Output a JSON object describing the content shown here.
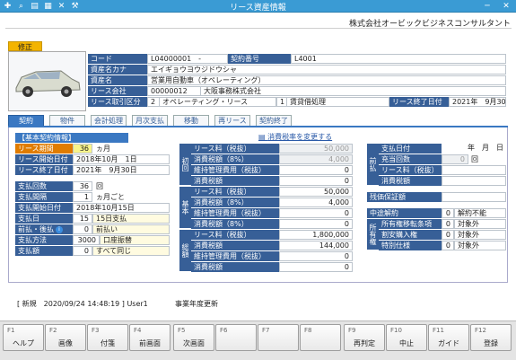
{
  "window": {
    "title": "リース資産情報"
  },
  "company": "株式会社オービックビジネスコンサルタント",
  "badge": "修正",
  "header": {
    "code_label": "コード",
    "code_value": "L04000001　-",
    "contract_no_label": "契約番号",
    "contract_no_value": "L4001",
    "asset_kana_label": "資産名カナ",
    "asset_kana_value": "エイギョウヨウジドウシャ",
    "asset_name_label": "資産名",
    "asset_name_value": "営業用自動車（オペレーティング）",
    "lessor_label": "リース会社",
    "lessor_code": "00000012",
    "lessor_name": "大阪事務株式会社",
    "category_label": "リース取引区分",
    "category_no": "2",
    "category_name": "オペレーティング・リース",
    "accounting_no": "1",
    "accounting_name": "賃貸借処理",
    "end_label": "リース終了日付",
    "end_value": "2021年　9月30日"
  },
  "tabs": [
    "契約",
    "物件",
    "会計処理",
    "月次支払",
    "移動",
    "再リース",
    "契約終了"
  ],
  "basic": {
    "section": "【基本契約情報】",
    "period_label": "リース期間",
    "period_value": "36",
    "period_unit": "ヵ月",
    "start_label": "リース開始日付",
    "start_value": "2018年10月　1日",
    "end_label": "リース終了日付",
    "end_value": "2021年　9月30日",
    "pay_count_label": "支払回数",
    "pay_count_value": "36",
    "pay_count_unit": "回",
    "pay_interval_label": "支払間隔",
    "pay_interval_value": "1",
    "pay_interval_unit": "ヵ月ごと",
    "pay_start_label": "支払開始日付",
    "pay_start_value": "2018年10月15日",
    "pay_day_label": "支払日",
    "pay_day_value": "15",
    "pay_day_text": "15日支払",
    "prepost_label": "前払・後払",
    "prepost_value": "0",
    "prepost_text": "前払い",
    "pay_method_label": "支払方法",
    "pay_method_value": "3000",
    "pay_method_text": "口座振替",
    "pay_amount_label": "支払額",
    "pay_amount_value": "0",
    "pay_amount_text": "すべて同じ"
  },
  "tax_link": "消費税率を変更する",
  "amounts": {
    "initial_label": "初回",
    "basic_label": "基本",
    "total_label": "総額",
    "rows_initial": [
      {
        "label": "リース料（税抜）",
        "value": "50,000",
        "grey": true
      },
      {
        "label": "消費税額（8%）",
        "value": "4,000",
        "grey": true
      },
      {
        "label": "維持管理費用（税抜）",
        "value": "0",
        "grey": false
      },
      {
        "label": "消費税額",
        "value": "0",
        "grey": false
      }
    ],
    "rows_basic": [
      {
        "label": "リース料（税抜）",
        "value": "50,000"
      },
      {
        "label": "消費税額（8%）",
        "value": "4,000"
      },
      {
        "label": "維持管理費用（税抜）",
        "value": "0"
      },
      {
        "label": "消費税額（8%）",
        "value": "0"
      }
    ],
    "rows_total": [
      {
        "label": "リース料（税抜）",
        "value": "1,800,000"
      },
      {
        "label": "消費税額",
        "value": "144,000"
      },
      {
        "label": "維持管理費用（税抜）",
        "value": "0"
      },
      {
        "label": "消費税額",
        "value": "0"
      }
    ]
  },
  "prepaid": {
    "side_label": "前払",
    "date_label": "支払日付",
    "date_value": "年　月　日",
    "count_label": "充当回数",
    "count_value": "0",
    "count_unit": "回",
    "lease_label": "リース料（税抜）",
    "lease_value": "",
    "tax_label": "消費税額",
    "tax_value": ""
  },
  "residual": {
    "label": "残価保証額",
    "value": ""
  },
  "ownership": {
    "side_label": "所有権",
    "rows": [
      {
        "label": "中途解約",
        "code": "0",
        "text": "解約不能"
      },
      {
        "label": "所有権移転条項",
        "code": "0",
        "text": "対象外"
      },
      {
        "label": "割安購入権",
        "code": "0",
        "text": "対象外"
      },
      {
        "label": "特別仕様",
        "code": "0",
        "text": "対象外"
      }
    ]
  },
  "status": {
    "text": "[ 新規　2020/09/24 14:48:19 ] User1",
    "note": "事業年度更新"
  },
  "fkeys": [
    {
      "fn": "F1",
      "label": "ヘルプ"
    },
    {
      "fn": "F2",
      "label": "画像"
    },
    {
      "fn": "F3",
      "label": "付箋"
    },
    {
      "fn": "F4",
      "label": "前画面"
    },
    {
      "fn": "F5",
      "label": "次画面"
    },
    {
      "fn": "F6",
      "label": ""
    },
    {
      "fn": "F7",
      "label": ""
    },
    {
      "fn": "F8",
      "label": ""
    },
    {
      "fn": "F9",
      "label": "再判定"
    },
    {
      "fn": "F10",
      "label": "中止"
    },
    {
      "fn": "F11",
      "label": "ガイド"
    },
    {
      "fn": "F12",
      "label": "登録"
    }
  ]
}
